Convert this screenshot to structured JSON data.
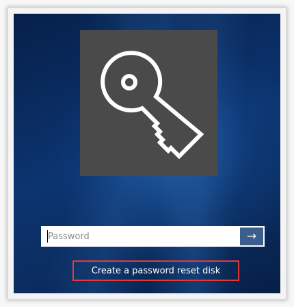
{
  "login": {
    "password_placeholder": "Password",
    "submit_glyph": "→",
    "reset_link_label": "Create a password reset disk"
  },
  "icons": {
    "user_tile": "key-icon",
    "submit": "arrow-right-icon"
  },
  "colors": {
    "tile_background": "#4a4a4a",
    "submit_background": "#3c5e8c",
    "highlight_border": "#e23a3a",
    "desktop_background": "#0c3470"
  }
}
